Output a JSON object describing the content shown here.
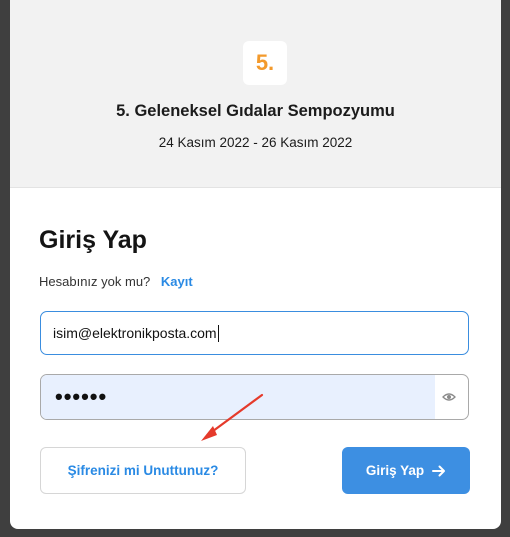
{
  "event": {
    "badge": "5.",
    "title": "5. Geleneksel Gıdalar Sempozyumu",
    "dates": "24 Kasım 2022 - 26 Kasım 2022"
  },
  "login": {
    "title": "Giriş Yap",
    "no_account_text": "Hesabınız yok mu?",
    "register_link": "Kayıt",
    "email_value": "isim@elektronikposta.com",
    "password_mask": "••••••",
    "forgot_label": "Şifrenizi mi Unuttunuz?",
    "submit_label": "Giriş Yap",
    "submit_icon": "arrow-right-icon"
  },
  "colors": {
    "accent": "#3d8fe2",
    "link": "#2a8ae4",
    "badge": "#f39a2c",
    "annotation": "#e53a2b"
  }
}
